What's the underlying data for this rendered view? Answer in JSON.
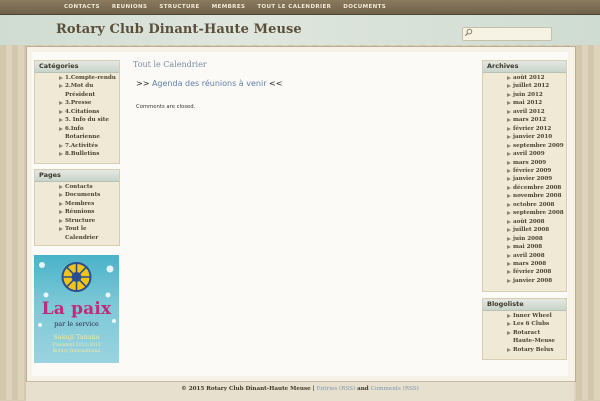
{
  "nav": [
    "CONTACTS",
    "REUNIONS",
    "STRUCTURE",
    "MEMBRES",
    "TOUT LE CALENDRIER",
    "DOCUMENTS"
  ],
  "site_title": "Rotary Club Dinant-Haute Meuse",
  "search": {
    "placeholder": ""
  },
  "categories": {
    "title": "Catégories",
    "items": [
      "1.Compte-rendu",
      "2.Mot du Président",
      "3.Presse",
      "4.Citations",
      "5. Info du site",
      "6.Info Rotarienne",
      "7.Activités",
      "8.Bulletins"
    ]
  },
  "pages": {
    "title": "Pages",
    "items": [
      "Contacts",
      "Documents",
      "Membres",
      "Réunions",
      "Structure",
      "Tout le Calendrier"
    ]
  },
  "banner": {
    "headline": "La paix",
    "subline": "par le service",
    "name": "Sakuji Tanaka",
    "role": "Président 2012-2013",
    "org": "Rotary International"
  },
  "main": {
    "heading": "Tout le Calendrier",
    "prefix": ">> ",
    "link": "Agenda des réunions à venir",
    "suffix": " <<",
    "comments": "Comments are closed."
  },
  "archives": {
    "title": "Archives",
    "items": [
      "août 2012",
      "juillet 2012",
      "juin 2012",
      "mai 2012",
      "avril 2012",
      "mars 2012",
      "février 2012",
      "janvier 2010",
      "septembre 2009",
      "avril 2009",
      "mars 2009",
      "février 2009",
      "janvier 2009",
      "décembre 2008",
      "novembre 2008",
      "octobre 2008",
      "septembre 2008",
      "août 2008",
      "juillet 2008",
      "juin 2008",
      "mai 2008",
      "avril 2008",
      "mars 2008",
      "février 2008",
      "janvier 2008"
    ]
  },
  "blogoliste": {
    "title": "Blogoliste",
    "items": [
      "Inner Wheel",
      "Les 6 Clubs",
      "Rotaract Haute-Meuse",
      "Rotary Belux"
    ]
  },
  "footer": {
    "copyright": "© 2015 Rotary Club Dinant-Haute Meuse | ",
    "entries": "Entries (RSS)",
    "and": " and ",
    "comments": "Comments (RSS)"
  },
  "colors": {
    "accent": "#c12a7b",
    "link": "#5f7fa8",
    "heading": "#7a8ea2"
  }
}
